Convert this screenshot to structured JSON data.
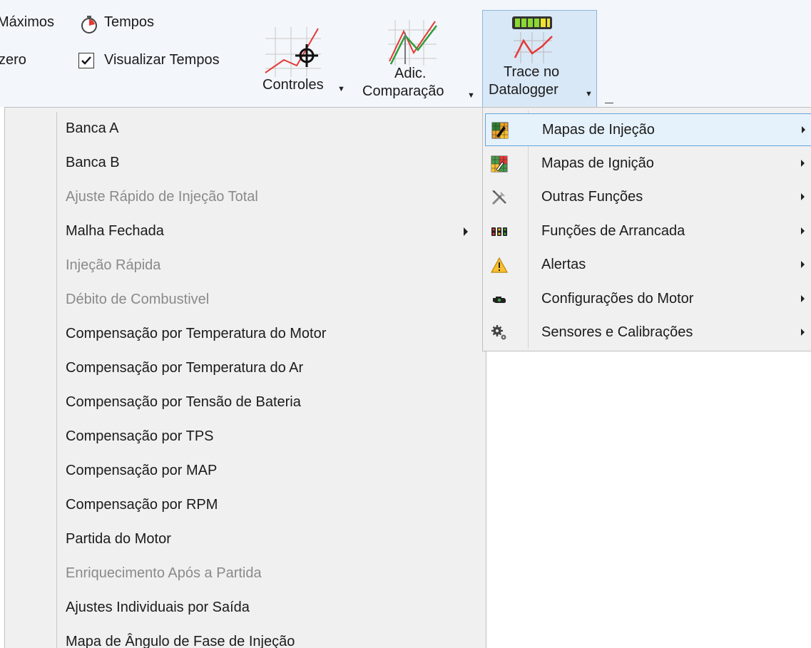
{
  "ribbon": {
    "maximos_label": "Máximos",
    "tempos_label": "Tempos",
    "zero_label": "zero",
    "visualizar_tempos_label": "Visualizar Tempos",
    "visualizar_tempos_checked": true,
    "controles_label": "Controles",
    "adic_line1": "Adic.",
    "adic_line2": "Comparação",
    "trace_line1": "Trace no",
    "trace_line2": "Datalogger",
    "dropdown_glyph": "▼"
  },
  "left_menu": {
    "items": [
      {
        "label": "Banca A",
        "enabled": true,
        "submenu": false
      },
      {
        "label": "Banca B",
        "enabled": true,
        "submenu": false
      },
      {
        "label": "Ajuste Rápido de Injeção Total",
        "enabled": false,
        "submenu": false
      },
      {
        "label": "Malha Fechada",
        "enabled": true,
        "submenu": true
      },
      {
        "label": "Injeção Rápida",
        "enabled": false,
        "submenu": false
      },
      {
        "label": "Débito de Combustivel",
        "enabled": false,
        "submenu": false
      },
      {
        "label": "Compensação por Temperatura do Motor",
        "enabled": true,
        "submenu": false
      },
      {
        "label": "Compensação por Temperatura do Ar",
        "enabled": true,
        "submenu": false
      },
      {
        "label": "Compensação por Tensão de Bateria",
        "enabled": true,
        "submenu": false
      },
      {
        "label": "Compensação por TPS",
        "enabled": true,
        "submenu": false
      },
      {
        "label": "Compensação por MAP",
        "enabled": true,
        "submenu": false
      },
      {
        "label": "Compensação por RPM",
        "enabled": true,
        "submenu": false
      },
      {
        "label": "Partida do Motor",
        "enabled": true,
        "submenu": false
      },
      {
        "label": "Enriquecimento Após a Partida",
        "enabled": false,
        "submenu": false
      },
      {
        "label": "Ajustes Individuais por Saída",
        "enabled": true,
        "submenu": false
      },
      {
        "label": "Mapa de Ângulo de Fase de Injeção",
        "enabled": true,
        "submenu": false
      }
    ]
  },
  "right_menu": {
    "items": [
      {
        "label": "Mapas de Injeção",
        "icon": "injection-map-icon",
        "highlighted": true
      },
      {
        "label": "Mapas de Ignição",
        "icon": "ignition-map-icon",
        "highlighted": false
      },
      {
        "label": "Outras Funções",
        "icon": "tools-icon",
        "highlighted": false
      },
      {
        "label": "Funções de Arrancada",
        "icon": "drag-lights-icon",
        "highlighted": false
      },
      {
        "label": "Alertas",
        "icon": "warning-icon",
        "highlighted": false
      },
      {
        "label": "Configurações do Motor",
        "icon": "engine-icon",
        "highlighted": false
      },
      {
        "label": "Sensores e Calibrações",
        "icon": "gears-icon",
        "highlighted": false
      }
    ]
  },
  "colors": {
    "ribbon_bg": "#f3f6fa",
    "menu_bg": "#f0f0f0",
    "highlight_bg": "#e5f1fb",
    "highlight_border": "#64a4dc",
    "disabled_text": "#8a8a8a"
  }
}
